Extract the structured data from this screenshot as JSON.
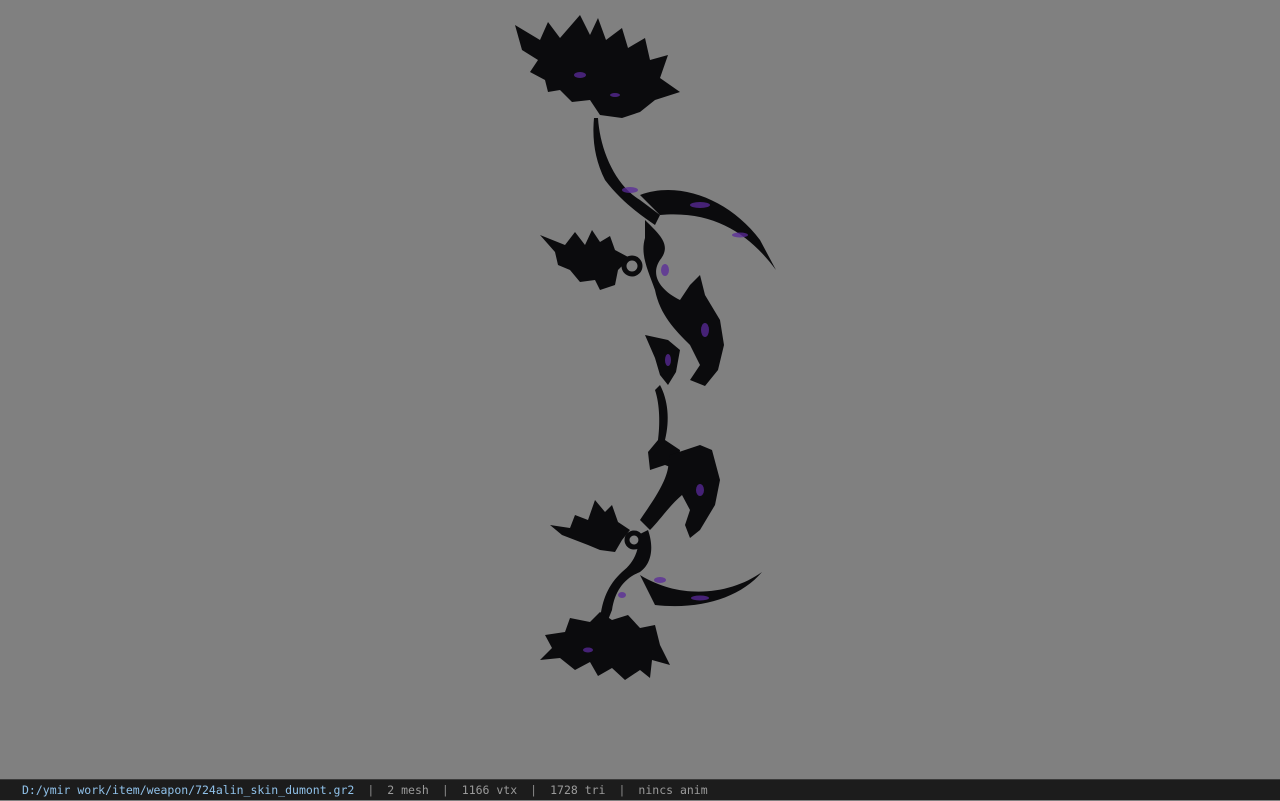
{
  "viewport": {
    "background": "#808080",
    "model": {
      "icon": "bow-model",
      "base_color": "#0b0b0d",
      "accent_color": "#5a2a9a"
    }
  },
  "status_bar": {
    "file_path": "D:/ymir work/item/weapon/724alin_skin_dumont.gr2",
    "separator": "|",
    "mesh_count": "2 mesh",
    "vertex_count": "1166 vtx",
    "triangle_count": "1728 tri",
    "animation": "nincs anim"
  }
}
